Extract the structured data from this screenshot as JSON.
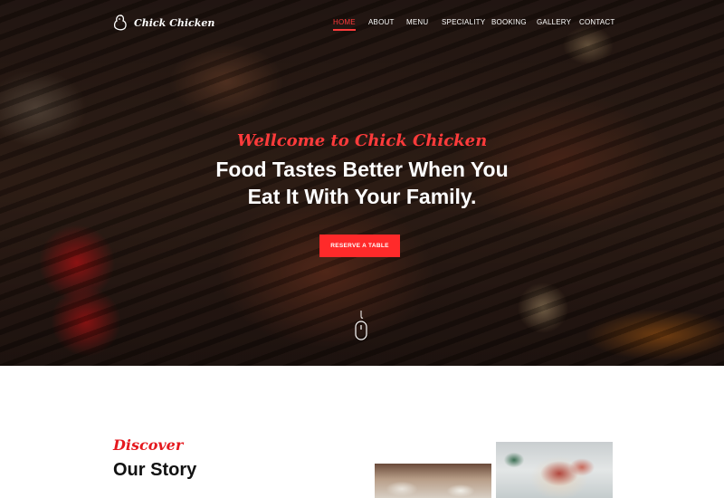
{
  "brand": {
    "name": "Chick Chicken",
    "logo_icon": "chicken-icon"
  },
  "nav": {
    "items": [
      {
        "label": "HOME",
        "active": true
      },
      {
        "label": "ABOUT",
        "active": false
      },
      {
        "label": "MENU",
        "active": false
      },
      {
        "label": "SPECIALITY",
        "active": false
      },
      {
        "label": "BOOKING",
        "active": false
      },
      {
        "label": "GALLERY",
        "active": false
      },
      {
        "label": "CONTACT",
        "active": false
      }
    ]
  },
  "hero": {
    "welcome": "Wellcome to Chick Chicken",
    "headline_line1": "Food Tastes Better When You",
    "headline_line2": "Eat It With Your Family.",
    "cta_label": "RESERVE A TABLE",
    "scroll_icon": "mouse-scroll-icon"
  },
  "story": {
    "kicker": "Discover",
    "title": "Our Story"
  },
  "colors": {
    "accent": "#ff2a2a",
    "accent_dark": "#e5191f",
    "text_dark": "#111111"
  }
}
